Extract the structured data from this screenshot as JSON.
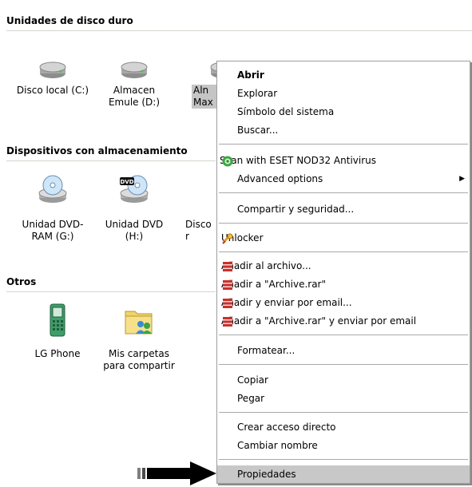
{
  "sections": {
    "hard_drives": "Unidades de disco duro",
    "removable": "Dispositivos con almacenamiento",
    "others": "Otros"
  },
  "hard_drive_items": [
    {
      "label": "Disco local (C:)"
    },
    {
      "label": "Almacen Emule (D:)"
    },
    {
      "label": "Aln Max"
    },
    {
      "label": ""
    }
  ],
  "removable_items": [
    {
      "label": "Unidad DVD-RAM (G:)"
    },
    {
      "label": "Unidad DVD (H:)"
    },
    {
      "label": "Disco r"
    }
  ],
  "other_items": [
    {
      "label": "LG Phone"
    },
    {
      "label": "Mis carpetas para compartir"
    }
  ],
  "context_menu": {
    "open": "Abrir",
    "explore": "Explorar",
    "cmd": "Símbolo del sistema",
    "search": "Buscar...",
    "eset": "Scan with ESET NOD32 Antivirus",
    "advanced": "Advanced options",
    "share": "Compartir y seguridad...",
    "unlocker": "Unlocker",
    "add_archive": "Añadir al archivo...",
    "add_rar": "Añadir a \"Archive.rar\"",
    "add_email": "Añadir y enviar por email...",
    "add_rar_email": "Añadir a \"Archive.rar\" y enviar por email",
    "format": "Formatear...",
    "copy": "Copiar",
    "paste": "Pegar",
    "shortcut": "Crear acceso directo",
    "rename": "Cambiar nombre",
    "properties": "Propiedades"
  },
  "colors": {
    "highlight": "#c8c8c8",
    "rar_icon": "#c8302c",
    "eset_icon": "#3aa843"
  }
}
